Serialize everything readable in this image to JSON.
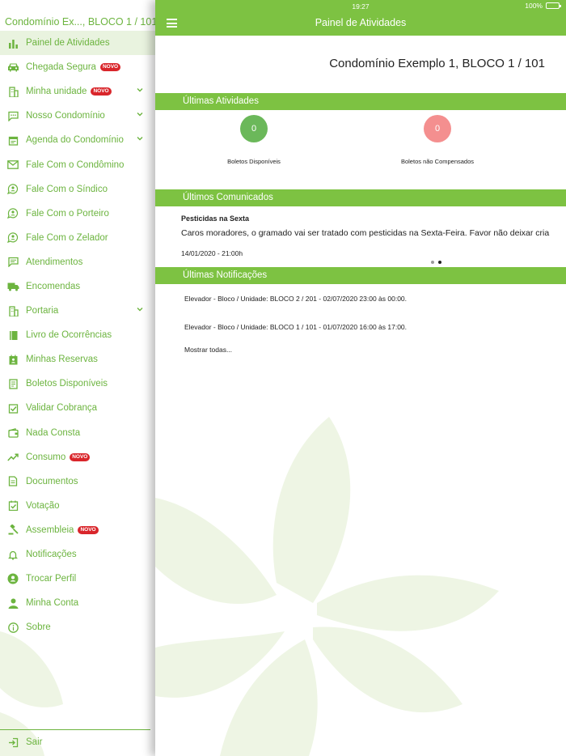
{
  "drawer": {
    "header": "Condomínio Ex..., BLOCO 1 / 101",
    "items": [
      {
        "label": "Painel de Atividades",
        "icon": "chart-bars-icon",
        "active": true
      },
      {
        "label": "Chegada Segura",
        "icon": "car-icon",
        "badge": "NOVO"
      },
      {
        "label": "Minha unidade",
        "icon": "building-icon",
        "badge": "NOVO",
        "expandable": true
      },
      {
        "label": "Nosso Condomínio",
        "icon": "chat-bubble-icon",
        "expandable": true
      },
      {
        "label": "Agenda do Condomínio",
        "icon": "calendar-icon",
        "expandable": true
      },
      {
        "label": "Fale Com o Condômino",
        "icon": "envelope-icon"
      },
      {
        "label": "Fale Com o Síndico",
        "icon": "person-talk-icon"
      },
      {
        "label": "Fale Com o Porteiro",
        "icon": "person-talk-icon"
      },
      {
        "label": "Fale Com o Zelador",
        "icon": "person-talk-icon"
      },
      {
        "label": "Atendimentos",
        "icon": "list-bubble-icon"
      },
      {
        "label": "Encomendas",
        "icon": "truck-icon"
      },
      {
        "label": "Portaria",
        "icon": "building-icon",
        "expandable": true
      },
      {
        "label": "Livro de Ocorrências",
        "icon": "book-icon"
      },
      {
        "label": "Minhas Reservas",
        "icon": "calendar-person-icon"
      },
      {
        "label": "Boletos Disponíveis",
        "icon": "receipt-icon"
      },
      {
        "label": "Validar Cobrança",
        "icon": "check-money-icon"
      },
      {
        "label": "Nada Consta",
        "icon": "wallet-icon"
      },
      {
        "label": "Consumo",
        "icon": "trend-up-icon",
        "badge": "NOVO"
      },
      {
        "label": "Documentos",
        "icon": "document-icon"
      },
      {
        "label": "Votação",
        "icon": "calendar-check-icon"
      },
      {
        "label": "Assembleia",
        "icon": "gavel-icon",
        "badge": "NOVO"
      },
      {
        "label": "Notificações",
        "icon": "bell-icon"
      },
      {
        "label": "Trocar Perfil",
        "icon": "profile-switch-icon"
      },
      {
        "label": "Minha Conta",
        "icon": "person-icon"
      },
      {
        "label": "Sobre",
        "icon": "info-icon"
      }
    ],
    "logout_label": "Sair",
    "logout_icon": "logout-icon"
  },
  "statusbar": {
    "time": "19:27",
    "battery": "100%"
  },
  "header": {
    "title": "Painel de Atividades",
    "menu_icon": "hamburger-icon"
  },
  "unit": "Condomínio Exemplo 1, BLOCO 1 / 101",
  "activities": {
    "heading": "Últimas Atividades",
    "stats": [
      {
        "value": "0",
        "label": "Boletos Disponíveis",
        "color": "#6bb85a"
      },
      {
        "value": "0",
        "label": "Boletos não Compensados",
        "color": "#f48f8f"
      }
    ]
  },
  "notices": {
    "heading": "Últimos Comunicados",
    "title": "Pesticidas na Sexta",
    "body": "Caros moradores, o gramado vai ser tratado com pesticidas na Sexta-Feira. Favor não deixar cria",
    "date": "14/01/2020 - 21:00h",
    "page_count": 2,
    "current_page": 2
  },
  "notifications": {
    "heading": "Últimas Notificações",
    "items": [
      "Elevador - Bloco / Unidade: BLOCO 2 / 201 - 02/07/2020 23:00 às 00:00.",
      "Elevador - Bloco / Unidade: BLOCO 1 / 101 - 01/07/2020 16:00 às 17:00."
    ],
    "show_all": "Mostrar todas..."
  },
  "colors": {
    "brand_green": "#7dc242",
    "menu_text": "#6cb43f",
    "badge_red": "#d9262b",
    "watermark": "#eef5e4"
  }
}
